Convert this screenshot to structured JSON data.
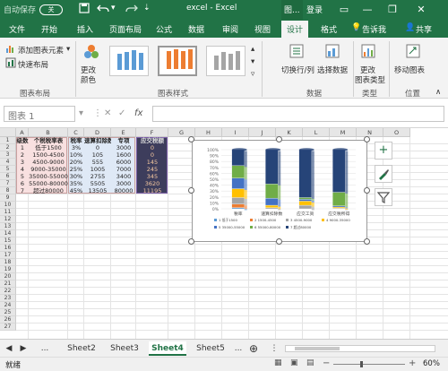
{
  "titlebar": {
    "autosave": "自动保存",
    "autosave_state": "关",
    "doc_title": "excel  -  Excel",
    "context_label": "图...",
    "login": "登录"
  },
  "tabs": [
    {
      "label": "文件"
    },
    {
      "label": "开始"
    },
    {
      "label": "插入"
    },
    {
      "label": "页面布局"
    },
    {
      "label": "公式"
    },
    {
      "label": "数据"
    },
    {
      "label": "审阅"
    },
    {
      "label": "视图"
    },
    {
      "label": "设计"
    },
    {
      "label": "格式"
    }
  ],
  "tell_me": "告诉我",
  "share": "共享",
  "ribbon": {
    "add_element": "添加图表元素",
    "quick_layout": "快速布局",
    "change_colors_1": "更改",
    "change_colors_2": "颜色",
    "group_layout": "图表布局",
    "group_styles": "图表样式",
    "switch_rowcol": "切换行/列",
    "select_data": "选择数据",
    "group_data": "数据",
    "change_type_1": "更改",
    "change_type_2": "图表类型",
    "group_type": "类型",
    "move_chart": "移动图表",
    "group_location": "位置"
  },
  "formula_bar": {
    "name_box": "图表 1",
    "cancel_icon": "✕",
    "enter_icon": "✓",
    "fx": "fx"
  },
  "sheet": {
    "columns": [
      "A",
      "B",
      "C",
      "D",
      "E",
      "F",
      "G",
      "H",
      "I",
      "J",
      "K",
      "L",
      "M",
      "N",
      "O"
    ],
    "rows": [
      "1",
      "2",
      "3",
      "4",
      "5",
      "6",
      "7",
      "8",
      "9",
      "10",
      "11",
      "12",
      "13",
      "14",
      "15",
      "16",
      "17",
      "18",
      "19",
      "20",
      "21",
      "22",
      "23",
      "24",
      "25",
      "26",
      "27"
    ],
    "table": [
      [
        "级数",
        "个税税率表",
        "税率",
        "速算扣除数",
        "专项",
        "应交税额"
      ],
      [
        "1",
        "低于1500",
        "3%",
        "0",
        "3000",
        "0"
      ],
      [
        "2",
        "1500-4500",
        "10%",
        "105",
        "1600",
        "0"
      ],
      [
        "3",
        "4500-9000",
        "20%",
        "555",
        "6000",
        "145"
      ],
      [
        "4",
        "9000-35000",
        "25%",
        "1005",
        "7000",
        "245"
      ],
      [
        "5",
        "35000-55000",
        "30%",
        "2755",
        "3400",
        "345"
      ],
      [
        "6",
        "55000-80000",
        "35%",
        "5505",
        "3000",
        "3620"
      ],
      [
        "7",
        "超过80000",
        "45%",
        "13505",
        "80000",
        "11195"
      ]
    ]
  },
  "chart": {
    "y_ticks": [
      "100%",
      "90%",
      "80%",
      "70%",
      "60%",
      "50%",
      "40%",
      "30%",
      "20%",
      "10%",
      "0%"
    ],
    "categories": [
      "税率",
      "速算扣除数",
      "应交工资",
      "应交税所得"
    ],
    "legend": [
      "1 低于1500",
      "2 1500-4500",
      "3 4500-9000",
      "4 9000-35000",
      "5 35000-55000",
      "6 55000-80000",
      "7 超过80000"
    ]
  },
  "chart_colors": [
    "#5b9bd5",
    "#ed7d31",
    "#a5a5a5",
    "#ffc000",
    "#4472c4",
    "#70ad47",
    "#264478"
  ],
  "chart_data": {
    "type": "bar",
    "stacked": "100%",
    "categories": [
      "税率",
      "速算扣除数",
      "应交工资",
      "应交税所得"
    ],
    "series": [
      {
        "name": "1 低于1500",
        "values": [
          2,
          0,
          0,
          0
        ]
      },
      {
        "name": "2 1500-4500",
        "values": [
          6,
          0,
          0,
          0
        ]
      },
      {
        "name": "3 4500-9000",
        "values": [
          11,
          2,
          6,
          1
        ]
      },
      {
        "name": "4 9000-35000",
        "values": [
          15,
          4,
          7,
          2
        ]
      },
      {
        "name": "5 35000-55000",
        "values": [
          18,
          12,
          3,
          2
        ]
      },
      {
        "name": "6 55000-80000",
        "values": [
          21,
          24,
          3,
          23
        ]
      },
      {
        "name": "7 超过80000",
        "values": [
          27,
          58,
          81,
          72
        ]
      }
    ],
    "ylim": [
      0,
      100
    ],
    "ylabel": "",
    "xlabel": ""
  },
  "sheet_tabs": [
    "Sheet2",
    "Sheet3",
    "Sheet4",
    "Sheet5"
  ],
  "active_sheet": "Sheet4",
  "status": {
    "ready": "就绪",
    "zoom": "60%"
  }
}
